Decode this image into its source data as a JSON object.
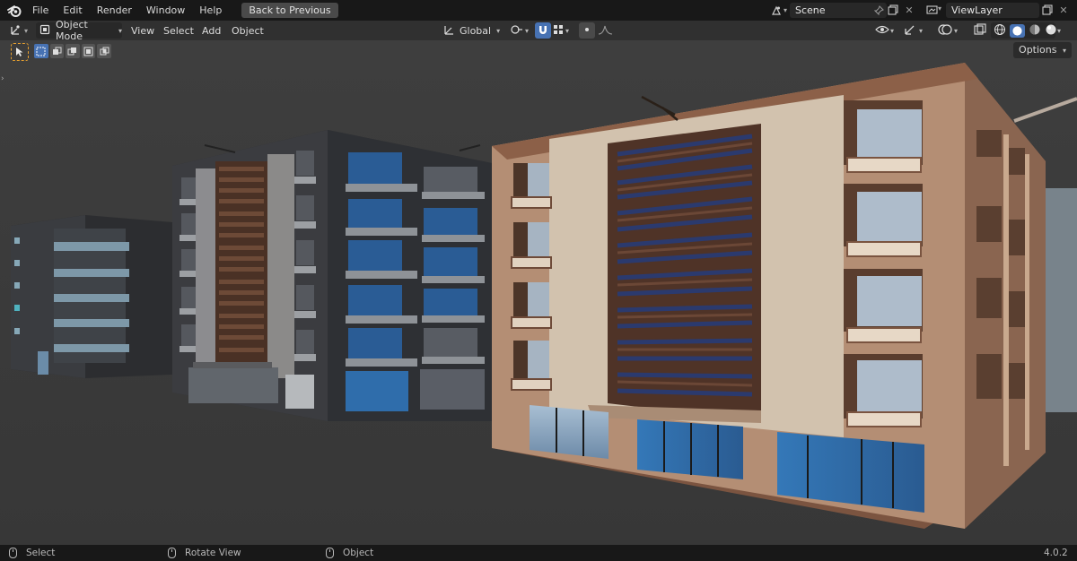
{
  "menu": {
    "items": [
      "File",
      "Edit",
      "Render",
      "Window",
      "Help"
    ],
    "back_button": "Back to Previous"
  },
  "scene_selector": {
    "value": "Scene"
  },
  "viewlayer_selector": {
    "value": "ViewLayer"
  },
  "header": {
    "mode": "Object Mode",
    "menus": [
      "View",
      "Select",
      "Add",
      "Object"
    ],
    "transform_orientation": "Global",
    "options_label": "Options"
  },
  "status": {
    "select": "Select",
    "rotate": "Rotate View",
    "object": "Object",
    "version": "4.0.2"
  },
  "colors": {
    "accent": "#4772b3",
    "topbar": "#181818",
    "header": "#303030",
    "viewport_bg": "#3d3d3d"
  },
  "icons": {
    "logo": "blender-logo-icon",
    "editor_type": "3d-viewport-icon",
    "scene": "scene-icon",
    "viewlayer": "viewlayer-icon",
    "pin": "pin-icon",
    "snap": "magnet-icon",
    "proportional": "proportional-edit-icon",
    "overlays": "overlays-icon",
    "xray": "xray-icon",
    "shading_solid": "solid-shading-icon"
  }
}
